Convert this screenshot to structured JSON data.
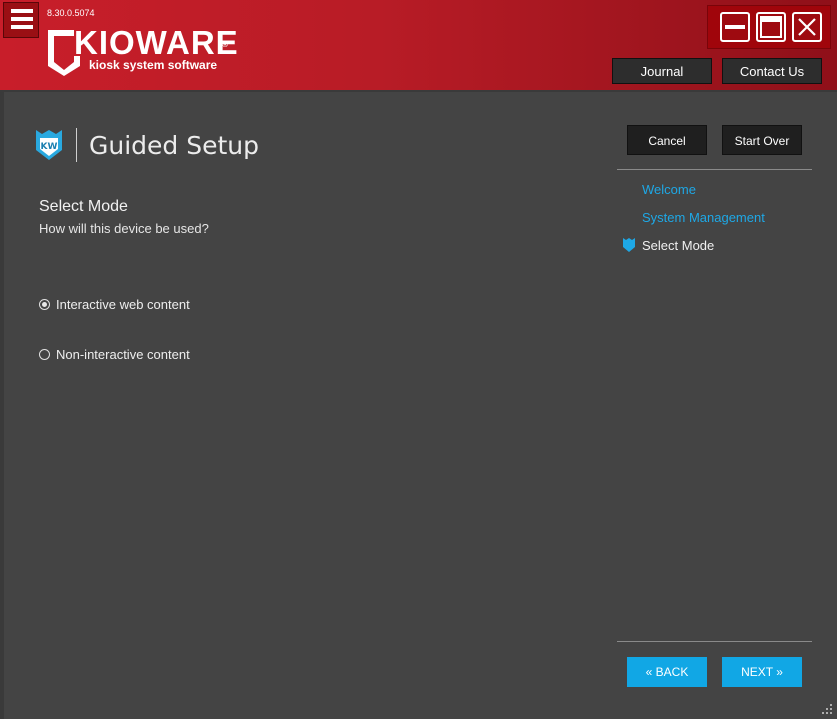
{
  "app": {
    "version": "8.30.0.5074",
    "logo_word": "KIOWARE",
    "logo_tagline": "kiosk system software",
    "logo_reg": "®"
  },
  "header": {
    "journal_label": "Journal",
    "contact_label": "Contact Us"
  },
  "page": {
    "title": "Guided Setup",
    "cancel_label": "Cancel",
    "start_over_label": "Start Over"
  },
  "steps": [
    {
      "label": "Welcome",
      "state": "done"
    },
    {
      "label": "System Management",
      "state": "done"
    },
    {
      "label": "Select Mode",
      "state": "current"
    }
  ],
  "main": {
    "section_title": "Select Mode",
    "section_subtitle": "How will this device be used?",
    "options": [
      {
        "label": "Interactive web content",
        "selected": true
      },
      {
        "label": "Non-interactive content",
        "selected": false
      }
    ]
  },
  "nav": {
    "back_label": "« BACK",
    "next_label": "NEXT »"
  },
  "colors": {
    "brand_red": "#c81e2a",
    "accent_blue": "#11a7e5",
    "background": "#444444"
  },
  "icons": {
    "menu": "hamburger-icon",
    "minimize": "minimize-icon",
    "maximize": "maximize-icon",
    "close": "close-icon",
    "shield": "kw-shield-icon",
    "step_marker": "shield-marker-icon",
    "resize": "resize-grip-icon"
  }
}
